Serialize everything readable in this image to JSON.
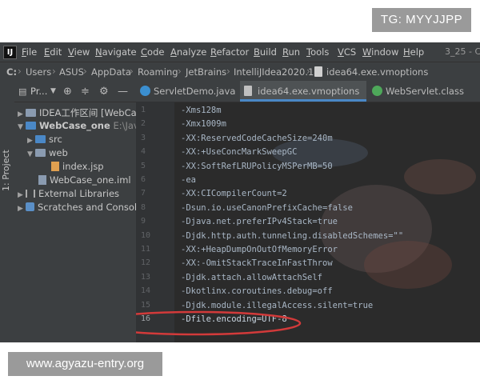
{
  "watermarks": {
    "tg": "TG: MYYJJPP",
    "site": "www.agyazu-entry.org"
  },
  "menubar": {
    "items": [
      "File",
      "Edit",
      "View",
      "Navigate",
      "Code",
      "Analyze",
      "Refactor",
      "Build",
      "Run",
      "Tools",
      "VCS",
      "Window",
      "Help"
    ],
    "title_fragment": "3_25 - C"
  },
  "breadcrumb": [
    "C:",
    "Users",
    "ASUS",
    "AppData",
    "Roaming",
    "JetBrains",
    "IntelliJIdea2020.1",
    "idea64.exe.vmoptions"
  ],
  "sidebar": {
    "tool_window_label": "1: Project",
    "header_label": "Pr...",
    "tree": [
      {
        "label": "IDEA工作区间 [WebCase",
        "icon": "folder-icon"
      },
      {
        "label": "WebCase_one",
        "path": "E:\\Java\\",
        "icon": "module-folder-icon"
      },
      {
        "label": "src",
        "icon": "source-folder-icon"
      },
      {
        "label": "web",
        "icon": "folder-icon"
      },
      {
        "label": "index.jsp",
        "icon": "jsp-file-icon"
      },
      {
        "label": "WebCase_one.iml",
        "icon": "iml-file-icon"
      },
      {
        "label": "External Libraries",
        "icon": "library-icon"
      },
      {
        "label": "Scratches and Consoles",
        "icon": "scratches-icon"
      }
    ]
  },
  "tabs": [
    {
      "label": "ServletDemo.java",
      "icon": "java-class-icon",
      "active": false
    },
    {
      "label": "idea64.exe.vmoptions",
      "icon": "vmoptions-file-icon",
      "active": true
    },
    {
      "label": "WebServlet.class",
      "icon": "class-file-icon",
      "active": false
    }
  ],
  "editor": {
    "lines": [
      {
        "n": "1",
        "text": "-Xms128m"
      },
      {
        "n": "2",
        "text": "-Xmx1009m"
      },
      {
        "n": "3",
        "text": "-XX:ReservedCodeCacheSize=240m"
      },
      {
        "n": "4",
        "text": "-XX:+UseConcMarkSweepGC"
      },
      {
        "n": "5",
        "text": "-XX:SoftRefLRUPolicyMSPerMB=50"
      },
      {
        "n": "6",
        "text": "-ea"
      },
      {
        "n": "7",
        "text": "-XX:CICompilerCount=2"
      },
      {
        "n": "8",
        "text": "-Dsun.io.useCanonPrefixCache=false"
      },
      {
        "n": "9",
        "text": "-Djava.net.preferIPv4Stack=true"
      },
      {
        "n": "10",
        "text": "-Djdk.http.auth.tunneling.disabledSchemes=\"\""
      },
      {
        "n": "11",
        "text": "-XX:+HeapDumpOnOutOfMemoryError"
      },
      {
        "n": "12",
        "text": "-XX:-OmitStackTraceInFastThrow"
      },
      {
        "n": "13",
        "text": "-Djdk.attach.allowAttachSelf"
      },
      {
        "n": "14",
        "text": "-Dkotlinx.coroutines.debug=off"
      },
      {
        "n": "15",
        "text": "-Djdk.module.illegalAccess.silent=true"
      },
      {
        "n": "16",
        "text": "-Dfile.encoding=UTF-8"
      }
    ],
    "highlight_color": "#d23a3a"
  },
  "colors": {
    "ide_bg": "#2b2b2b",
    "panel_bg": "#3c3f41",
    "code_text": "#a9b7c6",
    "accent": "#4a88c7"
  }
}
